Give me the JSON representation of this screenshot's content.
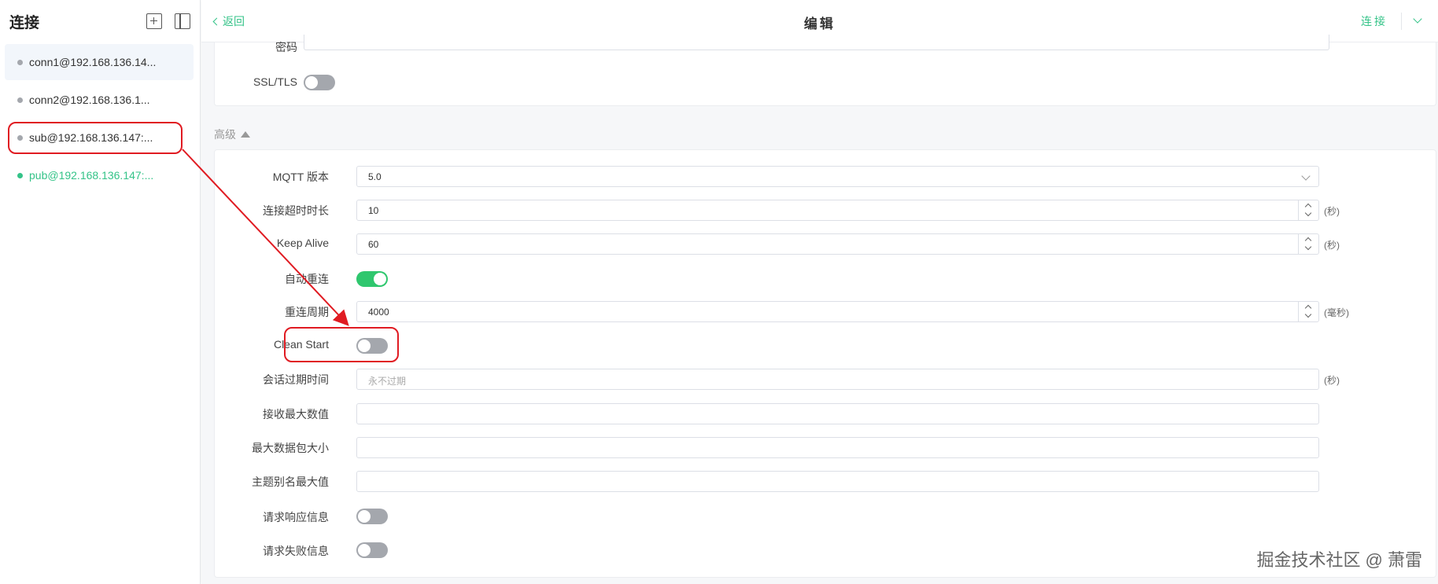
{
  "sidebar": {
    "title": "连接",
    "connections": [
      {
        "name": "conn1@192.168.136.14...",
        "online": false,
        "active": true
      },
      {
        "name": "conn2@192.168.136.1...",
        "online": false,
        "active": false
      },
      {
        "name": "sub@192.168.136.147:...",
        "online": false,
        "active": false
      },
      {
        "name": "pub@192.168.136.147:...",
        "online": true,
        "active": false
      }
    ]
  },
  "topbar": {
    "back": "返回",
    "title": "编辑",
    "connect": "连接"
  },
  "basic": {
    "password_label": "密码",
    "ssl_label": "SSL/TLS"
  },
  "advanced": {
    "title": "高级",
    "mqtt_version": {
      "label": "MQTT 版本",
      "value": "5.0"
    },
    "connect_timeout": {
      "label": "连接超时时长",
      "value": "10",
      "unit": "(秒)"
    },
    "keep_alive": {
      "label": "Keep Alive",
      "value": "60",
      "unit": "(秒)"
    },
    "auto_reconnect": {
      "label": "自动重连",
      "on": true
    },
    "reconnect_period": {
      "label": "重连周期",
      "value": "4000",
      "unit": "(毫秒)"
    },
    "clean_start": {
      "label": "Clean Start",
      "on": false
    },
    "session_expiry": {
      "label": "会话过期时间",
      "placeholder": "永不过期",
      "unit": "(秒)"
    },
    "receive_max": {
      "label": "接收最大数值",
      "value": ""
    },
    "max_packet": {
      "label": "最大数据包大小",
      "value": ""
    },
    "topic_alias_max": {
      "label": "主题别名最大值",
      "value": ""
    },
    "request_response": {
      "label": "请求响应信息",
      "on": false
    },
    "request_problem": {
      "label": "请求失败信息",
      "on": false
    }
  },
  "watermark": "掘金技术社区 @ 萧雷",
  "colors": {
    "accent": "#34c388",
    "annotation": "#e01b22"
  }
}
